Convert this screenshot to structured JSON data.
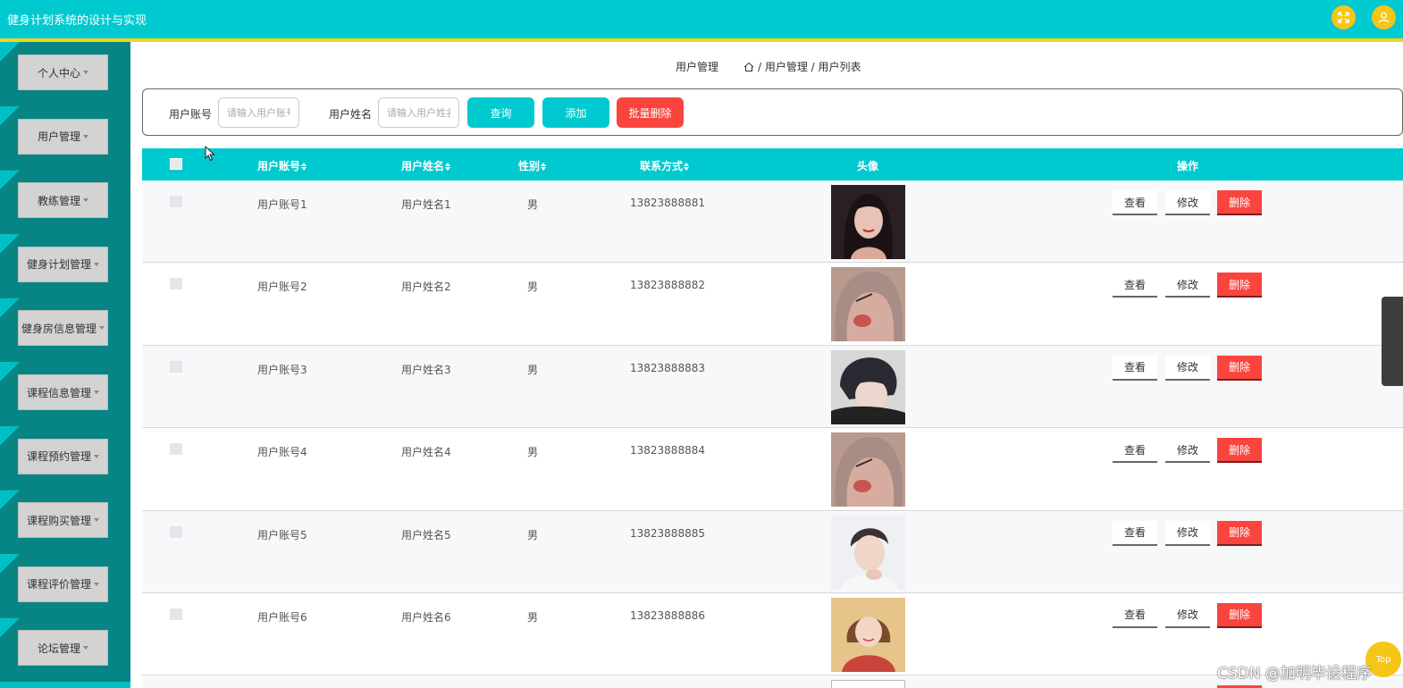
{
  "header": {
    "title": "健身计划系统的设计与实现"
  },
  "sidebar": {
    "items": [
      {
        "label": "个人中心"
      },
      {
        "label": "用户管理"
      },
      {
        "label": "教练管理"
      },
      {
        "label": "健身计划管理"
      },
      {
        "label": "健身房信息管理"
      },
      {
        "label": "课程信息管理"
      },
      {
        "label": "课程预约管理"
      },
      {
        "label": "课程购买管理"
      },
      {
        "label": "课程评价管理"
      },
      {
        "label": "论坛管理"
      }
    ]
  },
  "breadcrumb": {
    "title": "用户管理",
    "path": "/ 用户管理 / 用户列表"
  },
  "search": {
    "account_label": "用户账号",
    "account_placeholder": "请输入用户账号",
    "name_label": "用户姓名",
    "name_placeholder": "请输入用户姓名",
    "query_button": "查询",
    "add_button": "添加",
    "batch_delete_button": "批量删除"
  },
  "table": {
    "columns": [
      "用户账号",
      "用户姓名",
      "性别",
      "联系方式",
      "头像",
      "操作"
    ],
    "rows": [
      {
        "account": "用户账号1",
        "name": "用户姓名1",
        "gender": "男",
        "phone": "13823888881"
      },
      {
        "account": "用户账号2",
        "name": "用户姓名2",
        "gender": "男",
        "phone": "13823888882"
      },
      {
        "account": "用户账号3",
        "name": "用户姓名3",
        "gender": "男",
        "phone": "13823888883"
      },
      {
        "account": "用户账号4",
        "name": "用户姓名4",
        "gender": "男",
        "phone": "13823888884"
      },
      {
        "account": "用户账号5",
        "name": "用户姓名5",
        "gender": "男",
        "phone": "13823888885"
      },
      {
        "account": "用户账号6",
        "name": "用户姓名6",
        "gender": "男",
        "phone": "13823888886"
      }
    ],
    "actions": {
      "view": "查看",
      "edit": "修改",
      "delete": "删除"
    }
  },
  "top_button": "Top",
  "watermark": "CSDN @加明毕设程序",
  "colors": {
    "primary": "#00cad0",
    "accent": "#f5d51f",
    "danger": "#f9453e",
    "sidebar_shadow": "#078585"
  }
}
